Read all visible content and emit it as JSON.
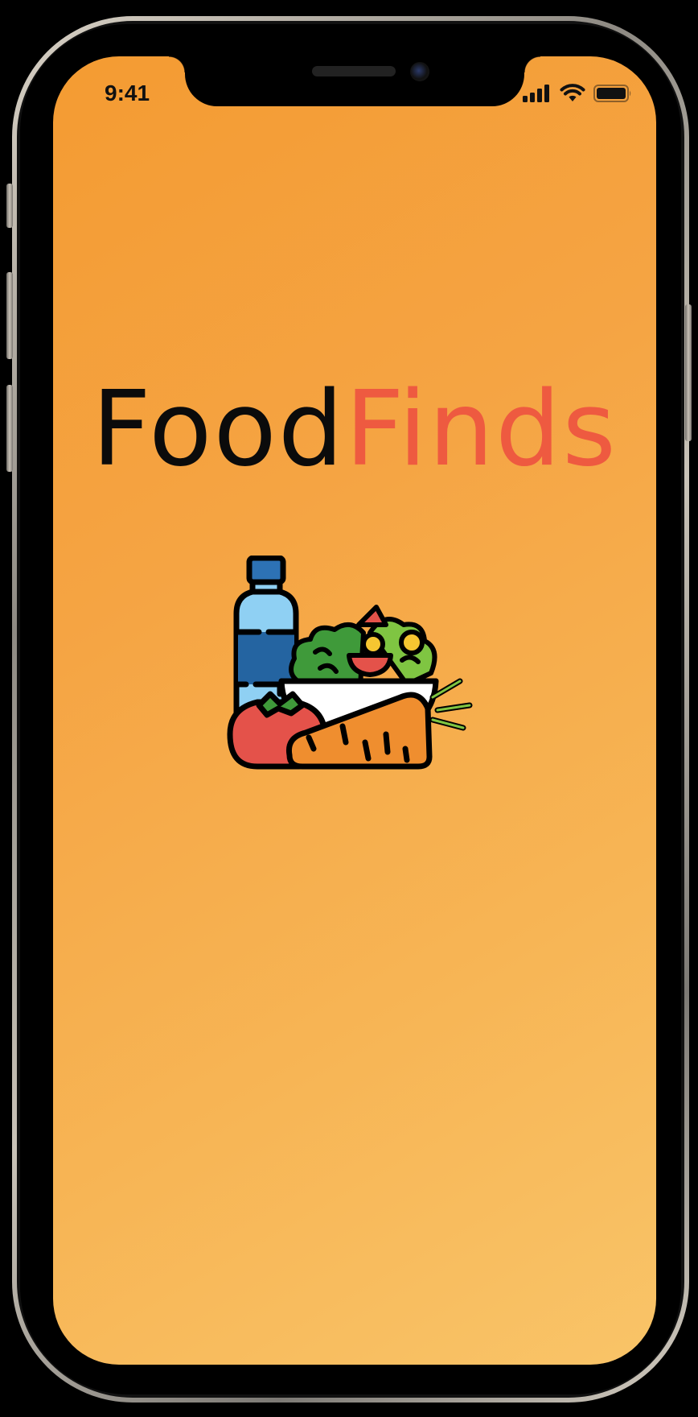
{
  "status_bar": {
    "time": "9:41",
    "icons": [
      "cellular-signal-icon",
      "wifi-icon",
      "battery-icon"
    ]
  },
  "app": {
    "name_part_1": "Food",
    "name_part_2": "Finds",
    "illustration": "groceries-illustration",
    "colors": {
      "background_start": "#f49b32",
      "background_end": "#f9c468",
      "name_part_1": "#0b0b0b",
      "name_part_2": "#ee5a40"
    }
  }
}
